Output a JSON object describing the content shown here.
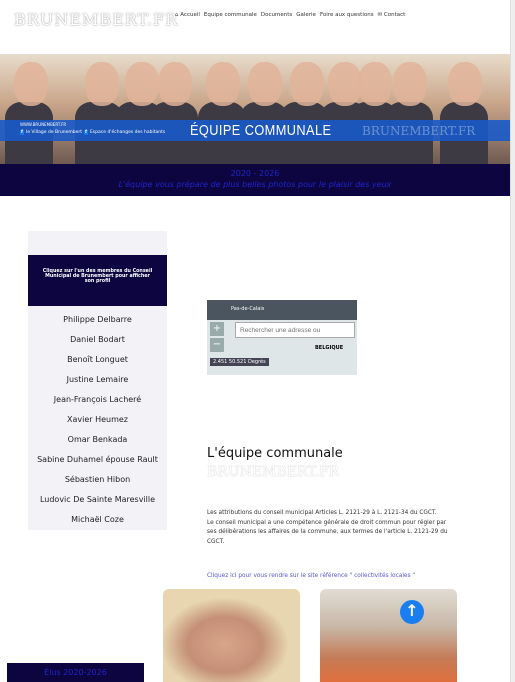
{
  "site": {
    "logo": "BRUNEMBERT.FR"
  },
  "nav": [
    "Accueil",
    "Equipe communale",
    "Documents",
    "Galerie",
    "Foire aux questions",
    "Contact"
  ],
  "hero": {
    "www": "WWW.BRUNEMBERT.FR",
    "fb1": "le Village de Brunembert",
    "fb2": "Espace d'échanges des habitants",
    "title": "ÉQUIPE COMMUNALE",
    "watermark": "BRUNEMBERT.FR"
  },
  "banner": {
    "years": "2020 - 2026",
    "subtitle": "L'équipe vous prépare de plus belles photos pour le plaisir des yeux"
  },
  "sidebar": {
    "intro": "Cliquez sur l'un des membres du Conseil Municipal de Brunembert pour afficher son profil",
    "members": [
      "Philippe Delbarre",
      "Daniel Bodart",
      "Benoît Longuet",
      "Justine Lemaire",
      "Jean-François Lacheré",
      "Xavier Heumez",
      "Omar Benkada",
      "Sabine Duhamel épouse Rault",
      "Sébastien Hibon",
      "Ludovic De Sainte Maresville",
      "Michaël Coze"
    ]
  },
  "map": {
    "brand": "Pas-de-Calais",
    "search_placeholder": "Rechercher une adresse ou",
    "coords": "2.451 50.521 Degrés",
    "label": "BELGIQUE"
  },
  "main": {
    "heading": "L'équipe communale",
    "watermark": "BRUNEMBERT.FR",
    "paragraphs": [
      "Les attributions du conseil municipal Articles L. 2121-29 à L. 2121-34 du CGCT.",
      "Le conseil municipal a une compétence générale de droit commun pour régler par ses délibérations les affaires de la commune, aux termes de l'article L. 2121-29 du CGCT."
    ],
    "link": "Cliquez ici pour vous rendre sur le site référence \" collectivités locales \""
  },
  "footer_box": "Élus 2020-2026"
}
